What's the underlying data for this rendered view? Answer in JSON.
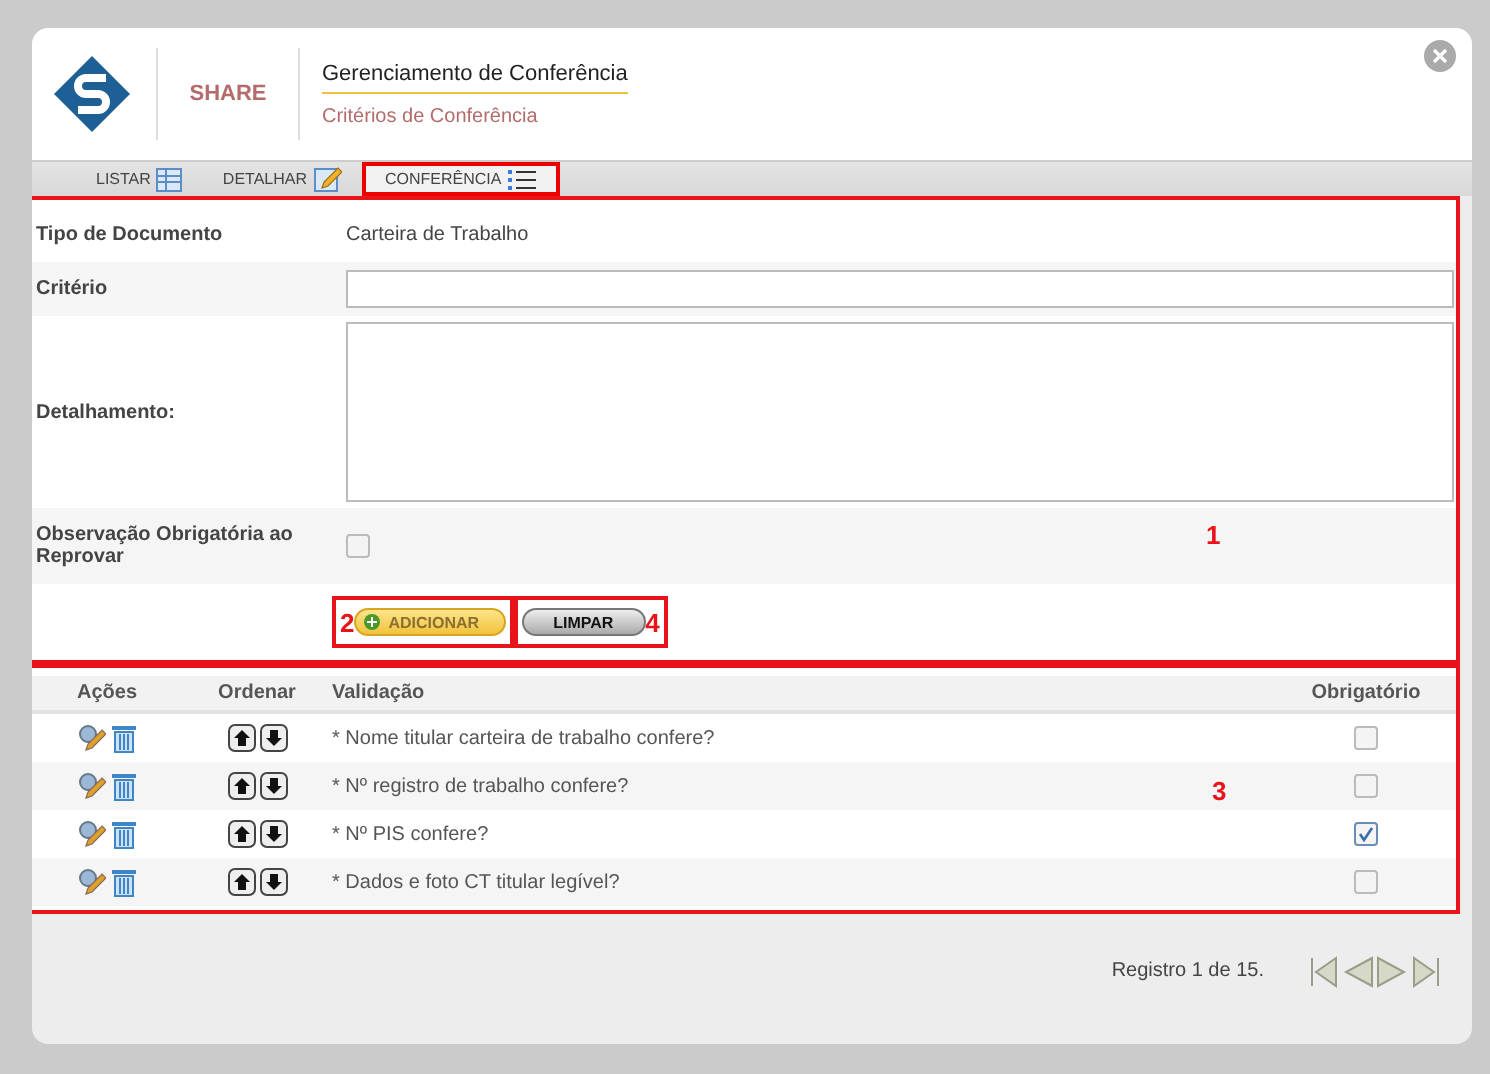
{
  "header": {
    "brand": "SHARE",
    "title": "Gerenciamento de Conferência",
    "subtitle": "Critérios de Conferência"
  },
  "tabs": [
    {
      "label": "LISTAR",
      "selected": false,
      "kind": "table"
    },
    {
      "label": "DETALHAR",
      "selected": false,
      "kind": "edit"
    },
    {
      "label": "CONFERÊNCIA",
      "selected": true,
      "kind": "list"
    }
  ],
  "form": {
    "marker": "1",
    "tipo_label": "Tipo de Documento",
    "tipo_value": "Carteira de Trabalho",
    "criterio_label": "Critério",
    "detalhamento_label": "Detalhamento:",
    "observacao_label": "Observação Obrigatória ao Reprovar",
    "observacao_checked": false,
    "buttons": [
      {
        "label": "ADICIONAR",
        "kind": "add",
        "marker": "2"
      },
      {
        "label": "LIMPAR",
        "kind": "clear",
        "marker": "4"
      }
    ]
  },
  "table": {
    "marker": "3",
    "columns": [
      "Ações",
      "Ordenar",
      "Validação",
      "Obrigatório"
    ],
    "rows": [
      {
        "validacao": "* Nome titular carteira de trabalho confere?",
        "obrigatorio": false
      },
      {
        "validacao": "* Nº registro de trabalho confere?",
        "obrigatorio": false
      },
      {
        "validacao": "* Nº PIS confere?",
        "obrigatorio": true
      },
      {
        "validacao": "* Dados e foto CT titular legível?",
        "obrigatorio": false
      }
    ]
  },
  "footer": {
    "pagination": "Registro 1 de 15."
  }
}
